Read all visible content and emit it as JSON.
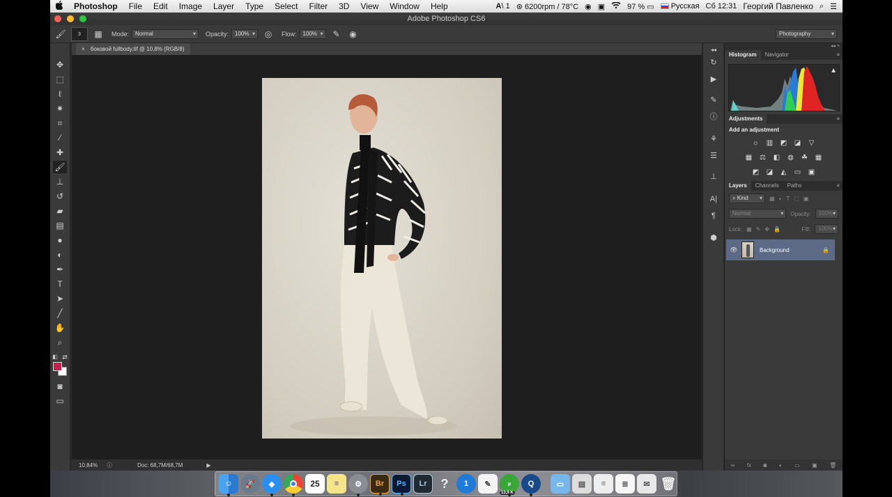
{
  "menubar": {
    "apple": "",
    "items": [
      "Photoshop",
      "File",
      "Edit",
      "Image",
      "Layer",
      "Type",
      "Select",
      "Filter",
      "3D",
      "View",
      "Window",
      "Help"
    ],
    "status": {
      "adobe": "1",
      "fan": "6200rpm / 78°C",
      "battery": "97 %",
      "input_source": "Русская",
      "clock": "Сб 12:31",
      "user": "Георгий Павленко"
    }
  },
  "window": {
    "title": "Adobe Photoshop CS6"
  },
  "options": {
    "brush_size": "3",
    "mode_label": "Mode:",
    "mode_value": "Normal",
    "opacity_label": "Opacity:",
    "opacity_value": "100%",
    "flow_label": "Flow:",
    "flow_value": "100%",
    "workspace": "Photography"
  },
  "document": {
    "tab_title": "боковой fullbody.tif @ 10,8% (RGB/8)",
    "zoom": "10,84%",
    "doc_size": "Doc: 68,7M/68,7M"
  },
  "colors": {
    "foreground": "#c0224e",
    "background": "#ffffff",
    "selected_layer": "#5d6a86"
  },
  "panels": {
    "histogram_tabs": [
      "Histogram",
      "Navigator"
    ],
    "adjustments_tab": "Adjustments",
    "adjustments_subtitle": "Add an adjustment",
    "layers_tabs": [
      "Layers",
      "Channels",
      "Paths"
    ],
    "layers_filter": "Kind",
    "blend_mode": "Normal",
    "opacity_label": "Opacity:",
    "opacity_value": "100%",
    "lock_label": "Lock:",
    "fill_label": "Fill:",
    "fill_value": "100%",
    "layer_name": "Background"
  },
  "dock": {
    "apps": [
      "finder-icon",
      "launchpad-icon",
      "safari-icon",
      "chrome-icon",
      "calendar-icon",
      "notes-icon",
      "system-preferences-icon",
      "bridge-icon",
      "photoshop-icon",
      "lightroom-icon",
      "help-icon",
      "1password-icon",
      "textedit-icon",
      "utorrent-icon",
      "quicktime-icon",
      "folder-icon",
      "preview-icon",
      "documents-icon",
      "documents-icon",
      "mail-icon",
      "trash-icon"
    ],
    "calendar_day": "25",
    "bridge_label": "Br",
    "photoshop_label": "Ps",
    "lightroom_label": "Lr",
    "utorrent_badge": "13,9 K"
  }
}
